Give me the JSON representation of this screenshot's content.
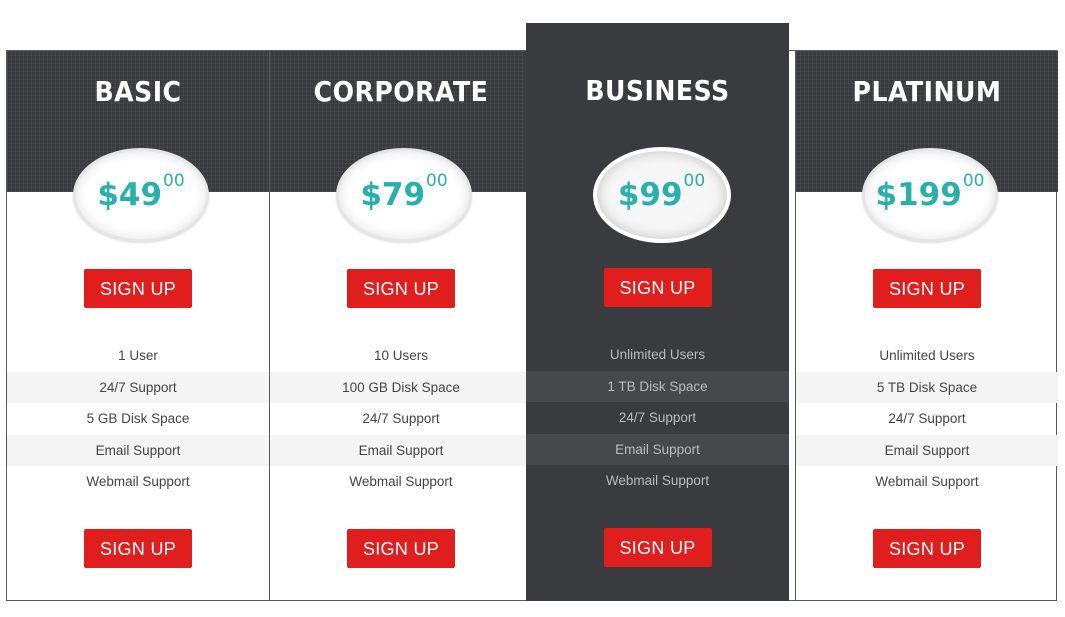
{
  "plans": [
    {
      "name": "BASIC",
      "price": "$49",
      "cents": "00",
      "signup_top": "SIGN UP",
      "signup_bottom": "SIGN UP",
      "features": [
        "1 User",
        "24/7 Support",
        "5 GB Disk Space",
        "Email Support",
        "Webmail Support"
      ]
    },
    {
      "name": "CORPORATE",
      "price": "$79",
      "cents": "00",
      "signup_top": "SIGN UP",
      "signup_bottom": "SIGN UP",
      "features": [
        "10 Users",
        "100 GB Disk Space",
        "24/7 Support",
        "Email Support",
        "Webmail Support"
      ]
    },
    {
      "name": "BUSINESS",
      "price": "$99",
      "cents": "00",
      "signup_top": "SIGN UP",
      "signup_bottom": "SIGN UP",
      "featured": true,
      "features": [
        "Unlimited Users",
        "1 TB Disk Space",
        "24/7 Support",
        "Email Support",
        "Webmail Support"
      ]
    },
    {
      "name": "PLATINUM",
      "price": "$199",
      "cents": "00",
      "signup_top": "SIGN UP",
      "signup_bottom": "SIGN UP",
      "features": [
        "Unlimited Users",
        "5 TB Disk Space",
        "24/7 Support",
        "Email Support",
        "Webmail Support"
      ]
    }
  ],
  "colors": {
    "header_bg": "#3a3b3f",
    "price_accent": "#2ab0ac",
    "button_bg": "#e01e1e",
    "button_text": "#ffffff"
  }
}
